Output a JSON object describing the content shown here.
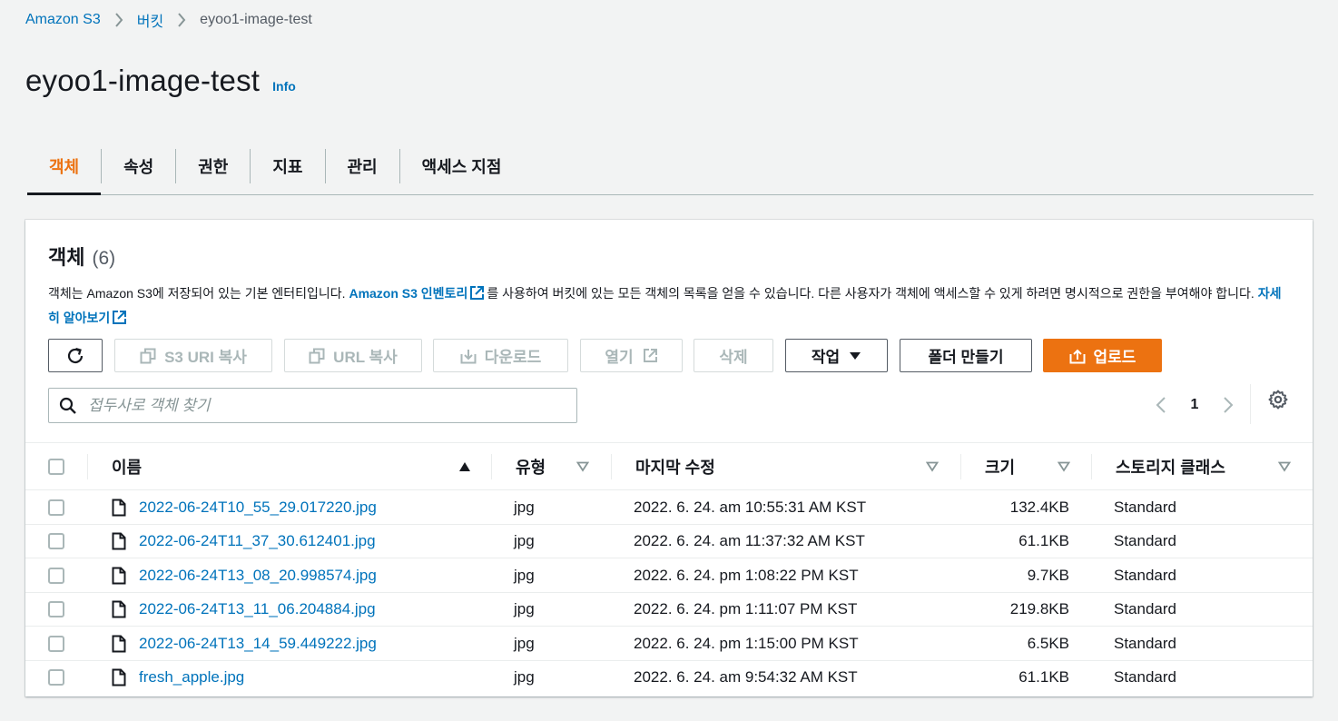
{
  "breadcrumb": {
    "items": [
      "Amazon S3",
      "버킷",
      "eyoo1-image-test"
    ]
  },
  "header": {
    "title": "eyoo1-image-test",
    "info": "Info"
  },
  "tabs": [
    "객체",
    "속성",
    "권한",
    "지표",
    "관리",
    "액세스 지점"
  ],
  "objects": {
    "title": "객체",
    "count": "(6)",
    "desc_part1": "객체는 Amazon S3에 저장되어 있는 기본 엔터티입니다. ",
    "desc_link1": "Amazon S3 인벤토리",
    "desc_part2": "를 사용하여 버킷에 있는 모든 객체의 목록을 얻을 수 있습니다. 다른 사용자가 객체에 액세스할 수 있게 하려면 명시적으로 권한을 부여해야 합니다. ",
    "desc_link2": "자세히 알아보기"
  },
  "toolbar": {
    "copy_s3_uri": "S3 URI 복사",
    "copy_url": "URL 복사",
    "download": "다운로드",
    "open": "열기",
    "delete": "삭제",
    "actions": "작업",
    "create_folder": "폴더 만들기",
    "upload": "업로드"
  },
  "search": {
    "placeholder": "접두사로 객체 찾기"
  },
  "pagination": {
    "page": "1"
  },
  "table": {
    "columns": {
      "name": "이름",
      "type": "유형",
      "modified": "마지막 수정",
      "size": "크기",
      "storage": "스토리지 클래스"
    },
    "rows": [
      {
        "name": "2022-06-24T10_55_29.017220.jpg",
        "type": "jpg",
        "modified": "2022. 6. 24. am 10:55:31 AM KST",
        "size": "132.4KB",
        "storage": "Standard"
      },
      {
        "name": "2022-06-24T11_37_30.612401.jpg",
        "type": "jpg",
        "modified": "2022. 6. 24. am 11:37:32 AM KST",
        "size": "61.1KB",
        "storage": "Standard"
      },
      {
        "name": "2022-06-24T13_08_20.998574.jpg",
        "type": "jpg",
        "modified": "2022. 6. 24. pm 1:08:22 PM KST",
        "size": "9.7KB",
        "storage": "Standard"
      },
      {
        "name": "2022-06-24T13_11_06.204884.jpg",
        "type": "jpg",
        "modified": "2022. 6. 24. pm 1:11:07 PM KST",
        "size": "219.8KB",
        "storage": "Standard"
      },
      {
        "name": "2022-06-24T13_14_59.449222.jpg",
        "type": "jpg",
        "modified": "2022. 6. 24. pm 1:15:00 PM KST",
        "size": "6.5KB",
        "storage": "Standard"
      },
      {
        "name": "fresh_apple.jpg",
        "type": "jpg",
        "modified": "2022. 6. 24. am 9:54:32 AM KST",
        "size": "61.1KB",
        "storage": "Standard"
      }
    ]
  },
  "colors": {
    "accent": "#ec7211",
    "link": "#0073bb",
    "text": "#16191f",
    "disabled": "#aab7b8"
  }
}
